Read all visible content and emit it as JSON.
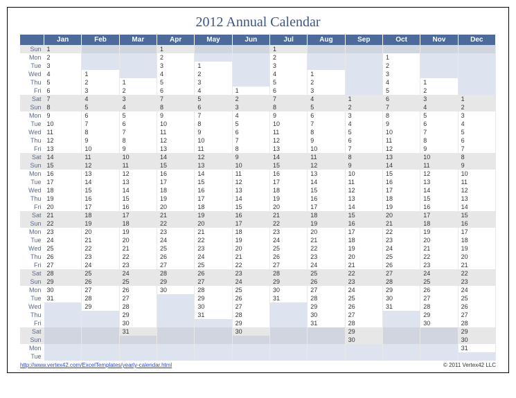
{
  "title": "2012 Annual Calendar",
  "months": [
    "Jan",
    "Feb",
    "Mar",
    "Apr",
    "May",
    "Jun",
    "Jul",
    "Aug",
    "Sep",
    "Oct",
    "Nov",
    "Dec"
  ],
  "rows": [
    {
      "dow": "Sun",
      "c": [
        "1",
        "",
        "",
        "1",
        "",
        "",
        "1",
        "",
        "",
        "",
        "",
        ""
      ]
    },
    {
      "dow": "Mon",
      "c": [
        "2",
        "",
        "",
        "2",
        "",
        "",
        "2",
        "",
        "",
        "1",
        "",
        ""
      ]
    },
    {
      "dow": "Tue",
      "c": [
        "3",
        "",
        "",
        "3",
        "1",
        "",
        "3",
        "",
        "",
        "2",
        "",
        ""
      ]
    },
    {
      "dow": "Wed",
      "c": [
        "4",
        "1",
        "",
        "4",
        "2",
        "",
        "4",
        "1",
        "",
        "3",
        "",
        ""
      ]
    },
    {
      "dow": "Thu",
      "c": [
        "5",
        "2",
        "1",
        "5",
        "3",
        "",
        "5",
        "2",
        "",
        "4",
        "1",
        ""
      ]
    },
    {
      "dow": "Fri",
      "c": [
        "6",
        "3",
        "2",
        "6",
        "4",
        "1",
        "6",
        "3",
        "",
        "5",
        "2",
        ""
      ]
    },
    {
      "dow": "Sat",
      "c": [
        "7",
        "4",
        "3",
        "7",
        "5",
        "2",
        "7",
        "4",
        "1",
        "6",
        "3",
        "1"
      ]
    },
    {
      "dow": "Sun",
      "c": [
        "8",
        "5",
        "4",
        "8",
        "6",
        "3",
        "8",
        "5",
        "2",
        "7",
        "4",
        "2"
      ]
    },
    {
      "dow": "Mon",
      "c": [
        "9",
        "6",
        "5",
        "9",
        "7",
        "4",
        "9",
        "6",
        "3",
        "8",
        "5",
        "3"
      ]
    },
    {
      "dow": "Tue",
      "c": [
        "10",
        "7",
        "6",
        "10",
        "8",
        "5",
        "10",
        "7",
        "4",
        "9",
        "6",
        "4"
      ]
    },
    {
      "dow": "Wed",
      "c": [
        "11",
        "8",
        "7",
        "11",
        "9",
        "6",
        "11",
        "8",
        "5",
        "10",
        "7",
        "5"
      ]
    },
    {
      "dow": "Thu",
      "c": [
        "12",
        "9",
        "8",
        "12",
        "10",
        "7",
        "12",
        "9",
        "6",
        "11",
        "8",
        "6"
      ]
    },
    {
      "dow": "Fri",
      "c": [
        "13",
        "10",
        "9",
        "13",
        "11",
        "8",
        "13",
        "10",
        "7",
        "12",
        "9",
        "7"
      ]
    },
    {
      "dow": "Sat",
      "c": [
        "14",
        "11",
        "10",
        "14",
        "12",
        "9",
        "14",
        "11",
        "8",
        "13",
        "10",
        "8"
      ]
    },
    {
      "dow": "Sun",
      "c": [
        "15",
        "12",
        "11",
        "15",
        "13",
        "10",
        "15",
        "12",
        "9",
        "14",
        "11",
        "9"
      ]
    },
    {
      "dow": "Mon",
      "c": [
        "16",
        "13",
        "12",
        "16",
        "14",
        "11",
        "16",
        "13",
        "10",
        "15",
        "12",
        "10"
      ]
    },
    {
      "dow": "Tue",
      "c": [
        "17",
        "14",
        "13",
        "17",
        "15",
        "12",
        "17",
        "14",
        "11",
        "16",
        "13",
        "11"
      ]
    },
    {
      "dow": "Wed",
      "c": [
        "18",
        "15",
        "14",
        "18",
        "16",
        "13",
        "18",
        "15",
        "12",
        "17",
        "14",
        "12"
      ]
    },
    {
      "dow": "Thu",
      "c": [
        "19",
        "16",
        "15",
        "19",
        "17",
        "14",
        "19",
        "16",
        "13",
        "18",
        "15",
        "13"
      ]
    },
    {
      "dow": "Fri",
      "c": [
        "20",
        "17",
        "16",
        "20",
        "18",
        "15",
        "20",
        "17",
        "14",
        "19",
        "16",
        "14"
      ]
    },
    {
      "dow": "Sat",
      "c": [
        "21",
        "18",
        "17",
        "21",
        "19",
        "16",
        "21",
        "18",
        "15",
        "20",
        "17",
        "15"
      ]
    },
    {
      "dow": "Sun",
      "c": [
        "22",
        "19",
        "18",
        "22",
        "20",
        "17",
        "22",
        "19",
        "16",
        "21",
        "18",
        "16"
      ]
    },
    {
      "dow": "Mon",
      "c": [
        "23",
        "20",
        "19",
        "23",
        "21",
        "18",
        "23",
        "20",
        "17",
        "22",
        "19",
        "17"
      ]
    },
    {
      "dow": "Tue",
      "c": [
        "24",
        "21",
        "20",
        "24",
        "22",
        "19",
        "24",
        "21",
        "18",
        "23",
        "20",
        "18"
      ]
    },
    {
      "dow": "Wed",
      "c": [
        "25",
        "22",
        "21",
        "25",
        "23",
        "20",
        "25",
        "22",
        "19",
        "24",
        "21",
        "19"
      ]
    },
    {
      "dow": "Thu",
      "c": [
        "26",
        "23",
        "22",
        "26",
        "24",
        "21",
        "26",
        "23",
        "20",
        "25",
        "22",
        "20"
      ]
    },
    {
      "dow": "Fri",
      "c": [
        "27",
        "24",
        "23",
        "27",
        "25",
        "22",
        "27",
        "24",
        "21",
        "26",
        "23",
        "21"
      ]
    },
    {
      "dow": "Sat",
      "c": [
        "28",
        "25",
        "24",
        "28",
        "26",
        "23",
        "28",
        "25",
        "22",
        "27",
        "24",
        "22"
      ]
    },
    {
      "dow": "Sun",
      "c": [
        "29",
        "26",
        "25",
        "29",
        "27",
        "24",
        "29",
        "26",
        "23",
        "28",
        "25",
        "23"
      ]
    },
    {
      "dow": "Mon",
      "c": [
        "30",
        "27",
        "26",
        "30",
        "28",
        "25",
        "30",
        "27",
        "24",
        "29",
        "26",
        "24"
      ]
    },
    {
      "dow": "Tue",
      "c": [
        "31",
        "28",
        "27",
        "",
        "29",
        "26",
        "31",
        "28",
        "25",
        "30",
        "27",
        "25"
      ]
    },
    {
      "dow": "Wed",
      "c": [
        "",
        "29",
        "28",
        "",
        "30",
        "27",
        "",
        "29",
        "26",
        "31",
        "28",
        "26"
      ]
    },
    {
      "dow": "Thu",
      "c": [
        "",
        "",
        "29",
        "",
        "31",
        "28",
        "",
        "30",
        "27",
        "",
        "29",
        "27"
      ]
    },
    {
      "dow": "Fri",
      "c": [
        "",
        "",
        "30",
        "",
        "",
        "29",
        "",
        "31",
        "28",
        "",
        "30",
        "28"
      ]
    },
    {
      "dow": "Sat",
      "c": [
        "",
        "",
        "31",
        "",
        "",
        "30",
        "",
        "",
        "29",
        "",
        "",
        "29"
      ]
    },
    {
      "dow": "Sun",
      "c": [
        "",
        "",
        "",
        "",
        "",
        "",
        "",
        "",
        "30",
        "",
        "",
        "30"
      ]
    },
    {
      "dow": "Mon",
      "c": [
        "",
        "",
        "",
        "",
        "",
        "",
        "",
        "",
        "",
        "",
        "",
        "31"
      ]
    },
    {
      "dow": "Tue",
      "c": [
        "",
        "",
        "",
        "",
        "",
        "",
        "",
        "",
        "",
        "",
        "",
        ""
      ]
    }
  ],
  "footer_link": "http://www.vertex42.com/ExcelTemplates/yearly-calendar.html",
  "copyright": "© 2011 Vertex42 LLC"
}
